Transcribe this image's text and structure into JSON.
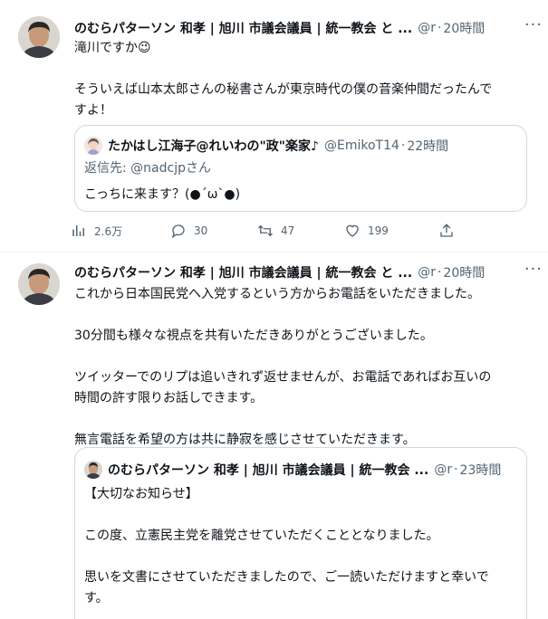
{
  "tweets": [
    {
      "author_name": "のむらパターソン 和孝 | 旭川 市議会議員 | 統一教会 と ...",
      "handle": "@r",
      "time": "20時間",
      "more": "···",
      "text_lines": [
        "滝川ですか😉",
        "",
        "そういえば山本太郎さんの秘書さんが東京時代の僕の音楽仲間だったんで",
        "すよ！"
      ],
      "quote": {
        "author_name": "たかはし江海子@れいわの\"政\"楽家♪",
        "handle": "@EmikoT14",
        "time": "22時間",
        "reply_to": "返信先: @nadcjpさん",
        "text_lines": [
          "こっちに来ます？(●´ω`●)"
        ]
      },
      "actions": {
        "views": "2.6万",
        "replies": "30",
        "retweets": "47",
        "likes": "199"
      }
    },
    {
      "author_name": "のむらパターソン 和孝 | 旭川 市議会議員 | 統一教会 と ...",
      "handle": "@r",
      "time": "20時間",
      "more": "···",
      "text_lines": [
        "これから日本国民党へ入党するという方からお電話をいただきました。",
        "",
        "30分間も様々な視点を共有いただきありがとうございました。",
        "",
        "ツイッターでのリプは追いきれず返せませんが、お電話であればお互いの",
        "時間の許す限りお話しできます。",
        "",
        "無言電話を希望の方は共に静寂を感じさせていただきます。"
      ],
      "quote": {
        "author_name": "のむらパターソン 和孝 | 旭川 市議会議員 | 統一教会 ...",
        "handle": "@r",
        "time": "23時間",
        "text_lines": [
          "【大切なお知らせ】",
          "",
          "この度、立憲民主党を離党させていただくこととなりました。",
          "",
          "思いを文書にさせていただきましたので、ご一読いただけますと幸いで",
          "す。"
        ]
      }
    }
  ],
  "dot": "·"
}
